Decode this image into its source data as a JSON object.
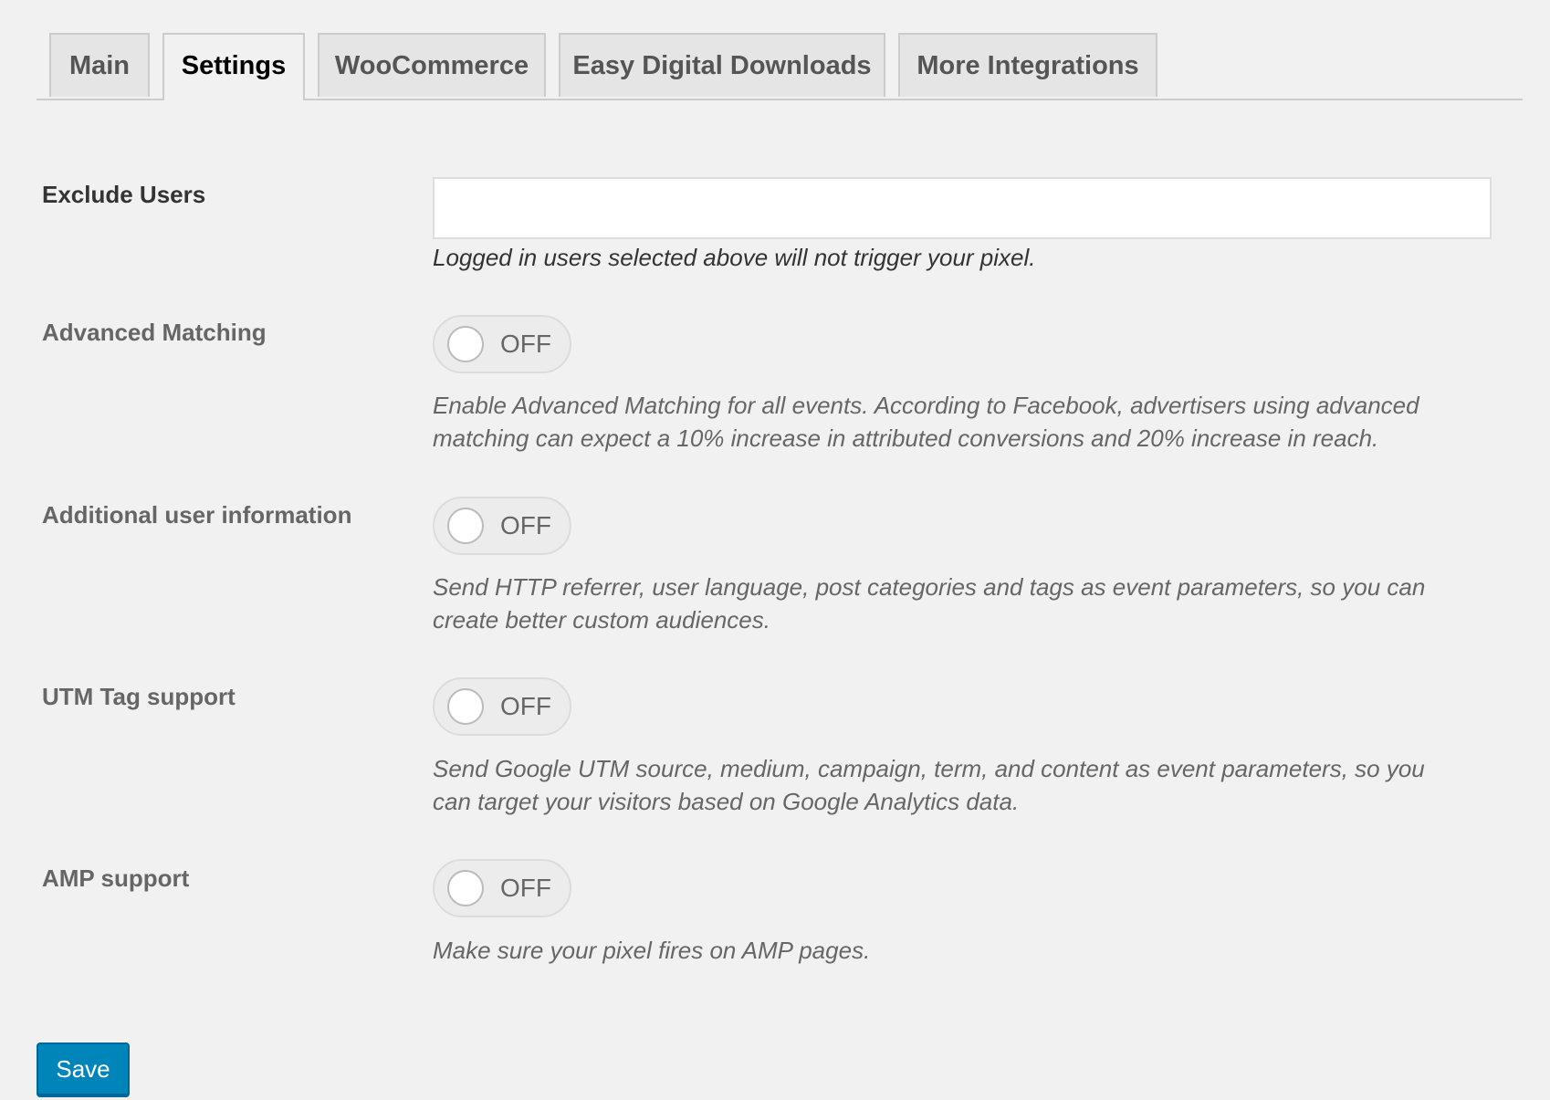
{
  "tabs": [
    {
      "label": "Main",
      "active": false
    },
    {
      "label": "Settings",
      "active": true
    },
    {
      "label": "WooCommerce",
      "active": false
    },
    {
      "label": "Easy Digital Downloads",
      "active": false
    },
    {
      "label": "More Integrations",
      "active": false
    }
  ],
  "settings": {
    "exclude_users": {
      "label": "Exclude Users",
      "value": "",
      "description": "Logged in users selected above will not trigger your pixel."
    },
    "advanced_matching": {
      "label": "Advanced Matching",
      "state": "OFF",
      "description_line1": "Enable Advanced Matching for all events. According to Facebook, advertisers using advanced",
      "description_line2": "matching can expect a 10% increase in attributed conversions and 20% increase in reach."
    },
    "additional_user_info": {
      "label": "Additional user information",
      "state": "OFF",
      "description_line1": "Send HTTP referrer, user language, post categories and tags as event parameters, so you can",
      "description_line2": "create better custom audiences."
    },
    "utm_tag_support": {
      "label": "UTM Tag support",
      "state": "OFF",
      "description_line1": "Send Google UTM source, medium, campaign, term, and content as event parameters, so you",
      "description_line2": "can target your visitors based on Google Analytics data."
    },
    "amp_support": {
      "label": "AMP support",
      "state": "OFF",
      "description": "Make sure your pixel fires on AMP pages."
    }
  },
  "actions": {
    "save_label": "Save"
  },
  "colors": {
    "background": "#f1f1f1",
    "primary_button": "#0085ba",
    "tab_inactive": "#e5e5e5",
    "border": "#cccccc"
  }
}
